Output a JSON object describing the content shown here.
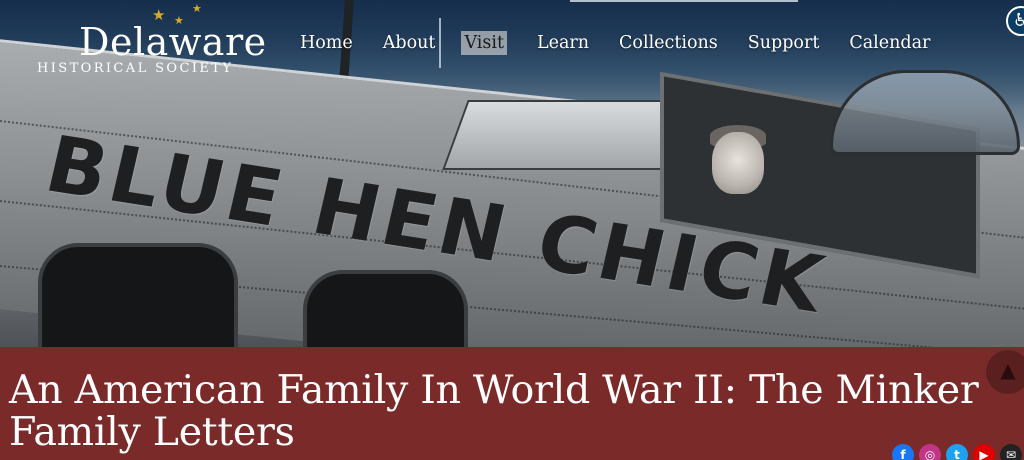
{
  "logo": {
    "name": "Delaware",
    "subtitle": "HISTORICAL SOCIETY"
  },
  "nav": {
    "items": [
      {
        "label": "Home"
      },
      {
        "label": "About"
      },
      {
        "label": "Visit"
      },
      {
        "label": "Learn"
      },
      {
        "label": "Collections"
      },
      {
        "label": "Support"
      },
      {
        "label": "Calendar"
      }
    ]
  },
  "hero": {
    "nose_art_text": "BLUE HEN CHICK"
  },
  "page": {
    "title": "An American Family In World War II: The Minker Family Letters"
  },
  "social": [
    {
      "name": "facebook-icon",
      "glyph": "f",
      "color": "#1877f2"
    },
    {
      "name": "instagram-icon",
      "glyph": "◎",
      "color": "#c13584"
    },
    {
      "name": "twitter-icon",
      "glyph": "t",
      "color": "#1da1f2"
    },
    {
      "name": "youtube-icon",
      "glyph": "▶",
      "color": "#e00000"
    },
    {
      "name": "email-icon",
      "glyph": "✉",
      "color": "#222222"
    }
  ],
  "colors": {
    "title_band": "#7b2a2a",
    "star": "#d7a92c",
    "accessibility": "#0d3d63"
  }
}
